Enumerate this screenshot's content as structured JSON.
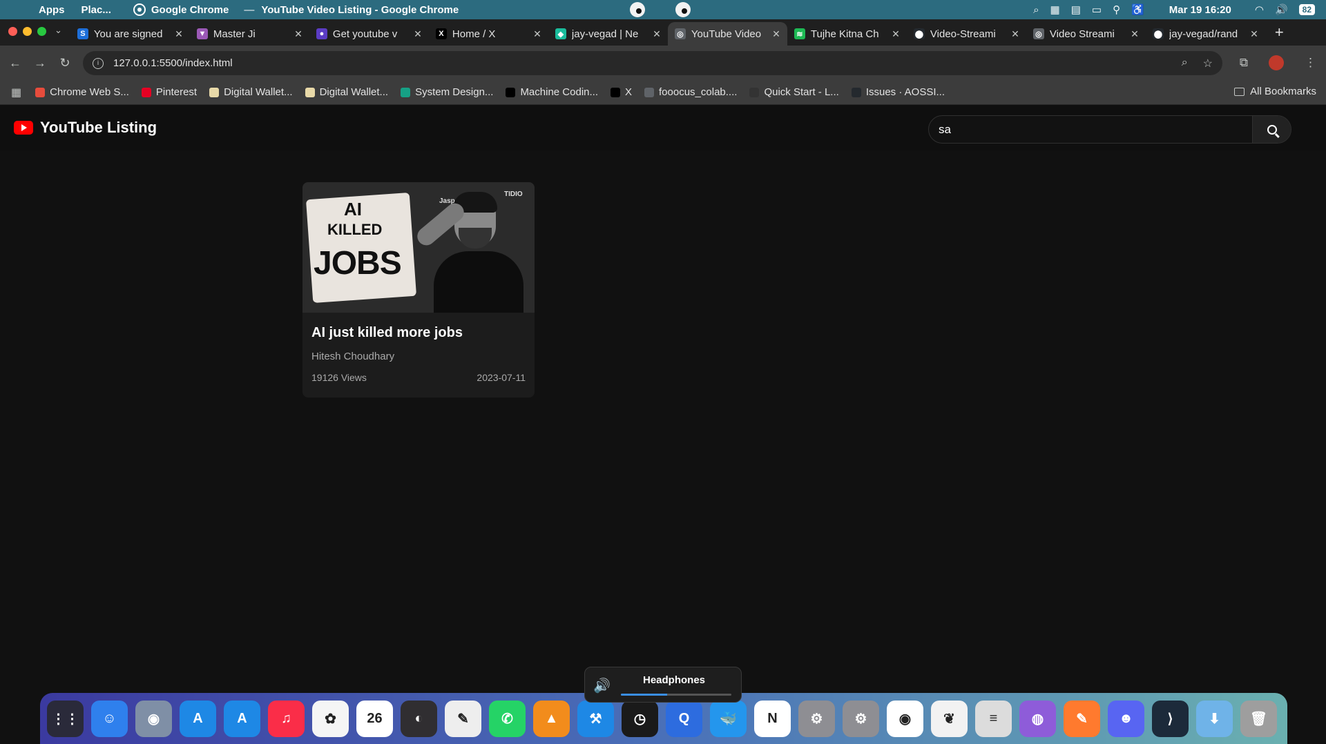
{
  "menubar": {
    "menus": [
      "Apps",
      "Plac...",
      "Google Chrome"
    ],
    "window_title": "YouTube Video Listing - Google Chrome",
    "separator": "—",
    "clock": "Mar 19  16:20",
    "battery": "82"
  },
  "tabs": [
    {
      "title": "You are signed",
      "fav_color": "#1e6fd9",
      "fav_glyph": "S"
    },
    {
      "title": "Master Ji",
      "fav_color": "#9b59b6",
      "fav_glyph": "▼"
    },
    {
      "title": "Get youtube v",
      "fav_color": "#5b3cc4",
      "fav_glyph": "●"
    },
    {
      "title": "Home / X",
      "fav_color": "#000000",
      "fav_glyph": "X"
    },
    {
      "title": "jay-vegad | Ne",
      "fav_color": "#1abc9c",
      "fav_glyph": "◆"
    },
    {
      "title": "YouTube Video",
      "fav_color": "#5f6368",
      "fav_glyph": "◎"
    },
    {
      "title": "Tujhe Kitna Ch",
      "fav_color": "#1db954",
      "fav_glyph": "≋"
    },
    {
      "title": "Video-Streami",
      "fav_color": "#24292e",
      "fav_glyph": "⬤"
    },
    {
      "title": "Video Streami",
      "fav_color": "#5f6368",
      "fav_glyph": "◎"
    },
    {
      "title": "jay-vegad/rand",
      "fav_color": "#24292e",
      "fav_glyph": "⬤"
    }
  ],
  "active_tab_index": 5,
  "new_tab": "+",
  "omnibox": {
    "url": "127.0.0.1:5500/index.html",
    "info": "i"
  },
  "bookmarks": [
    {
      "label": "Chrome Web S...",
      "color": "#e74c3c"
    },
    {
      "label": "Pinterest",
      "color": "#e60023"
    },
    {
      "label": "Digital Wallet...",
      "color": "#e8d9a8"
    },
    {
      "label": "Digital Wallet...",
      "color": "#e8d9a8"
    },
    {
      "label": "System Design...",
      "color": "#16a085"
    },
    {
      "label": "Machine Codin...",
      "color": "#000000"
    },
    {
      "label": "X",
      "color": "#000000"
    },
    {
      "label": "fooocus_colab....",
      "color": "#5f6368"
    },
    {
      "label": "Quick Start - L...",
      "color": "#333333"
    },
    {
      "label": "Issues · AOSSI...",
      "color": "#24292e"
    }
  ],
  "all_bookmarks": "All Bookmarks",
  "site": {
    "title": "YouTube Listing",
    "search_value": "sa"
  },
  "video": {
    "thumb_line1": "AI",
    "thumb_line2": "KILLED",
    "thumb_line3": "JOBS",
    "thumb_brand1": "Jasper",
    "thumb_brand2": "TIDIO",
    "title": "AI just killed more jobs",
    "channel": "Hitesh Choudhary",
    "views": "19126 Views",
    "date": "2023-07-11"
  },
  "hud": {
    "label": "Headphones",
    "volume": 0.42
  },
  "dock_apps": [
    {
      "name": "launchpad",
      "color": "#2a2a3a",
      "glyph": "⋮⋮"
    },
    {
      "name": "finder",
      "color": "#2f80ed",
      "glyph": "☺"
    },
    {
      "name": "contacts",
      "color": "#7f8fa6",
      "glyph": "◉"
    },
    {
      "name": "app-store-update",
      "color": "#1e88e5",
      "glyph": "A"
    },
    {
      "name": "app-store",
      "color": "#1e88e5",
      "glyph": "A"
    },
    {
      "name": "music",
      "color": "#fa2d48",
      "glyph": "♫"
    },
    {
      "name": "photos",
      "color": "#f5f5f5",
      "glyph": "✿"
    },
    {
      "name": "calendar",
      "color": "#ffffff",
      "glyph": "26"
    },
    {
      "name": "obs",
      "color": "#302e31",
      "glyph": "◐"
    },
    {
      "name": "textedit",
      "color": "#eeeeee",
      "glyph": "✎"
    },
    {
      "name": "whatsapp",
      "color": "#25d366",
      "glyph": "✆"
    },
    {
      "name": "vlc",
      "color": "#f28c1c",
      "glyph": "▲"
    },
    {
      "name": "xcode",
      "color": "#1e88e5",
      "glyph": "⚒"
    },
    {
      "name": "clock",
      "color": "#1a1a1a",
      "glyph": "◷"
    },
    {
      "name": "quicktime",
      "color": "#2d6cdf",
      "glyph": "Q"
    },
    {
      "name": "docker",
      "color": "#2496ed",
      "glyph": "🐳"
    },
    {
      "name": "notion",
      "color": "#ffffff",
      "glyph": "N"
    },
    {
      "name": "system-preferences",
      "color": "#8e8e93",
      "glyph": "⚙"
    },
    {
      "name": "system-settings",
      "color": "#8e8e93",
      "glyph": "⚙"
    },
    {
      "name": "chrome",
      "color": "#ffffff",
      "glyph": "◉"
    },
    {
      "name": "mongodb-compass",
      "color": "#f2f2f2",
      "glyph": "❦"
    },
    {
      "name": "database",
      "color": "#dcdcdc",
      "glyph": "≡"
    },
    {
      "name": "github-desktop",
      "color": "#8e5cd9",
      "glyph": "◍"
    },
    {
      "name": "pencil-app",
      "color": "#ff7a2e",
      "glyph": "✎"
    },
    {
      "name": "discord",
      "color": "#5865f2",
      "glyph": "☻"
    },
    {
      "name": "vscode",
      "color": "#1c2a3a",
      "glyph": "⟩"
    },
    {
      "name": "downloads-folder",
      "color": "#6fb3e8",
      "glyph": "⬇"
    },
    {
      "name": "trash",
      "color": "#9e9e9e",
      "glyph": "🗑"
    }
  ]
}
